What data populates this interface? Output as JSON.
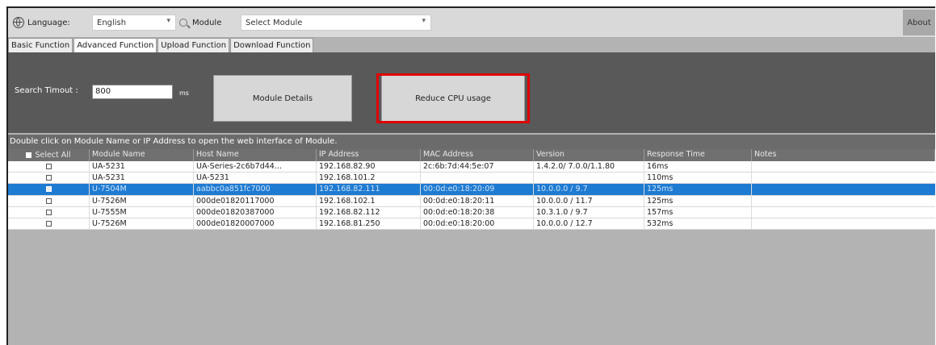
{
  "toolbar": {
    "language_label": "Language:",
    "language_value": "English",
    "module_label": "Module",
    "module_value": "Select Module",
    "about_label": "About"
  },
  "tabs": [
    {
      "label": "Basic Function",
      "active": false
    },
    {
      "label": "Advanced Function",
      "active": true
    },
    {
      "label": "Upload Function",
      "active": false
    },
    {
      "label": "Download Function",
      "active": false
    }
  ],
  "panel": {
    "search_timeout_label": "Search Timout :",
    "search_timeout_value": "800",
    "unit": "ms",
    "module_details_button": "Module Details",
    "reduce_cpu_button": "Reduce CPU usage",
    "highlight_color": "#e00000"
  },
  "hint": "Double click on Module Name or IP Address to open the web interface of Module.",
  "table": {
    "headers": [
      "Select All",
      "Module Name",
      "Host Name",
      "IP Address",
      "MAC Address",
      "Version",
      "Response Time",
      "Notes"
    ],
    "rows": [
      {
        "checked": false,
        "selected": false,
        "cells": [
          "UA-5231",
          "UA-Series-2c6b7d44...",
          "192.168.82.90",
          "2c:6b:7d:44:5e:07",
          "1.4.2.0/ 7.0.0/1.1.80",
          "16ms",
          ""
        ]
      },
      {
        "checked": false,
        "selected": false,
        "cells": [
          "UA-5231",
          "UA-5231",
          "192.168.101.2",
          "",
          "",
          "110ms",
          ""
        ]
      },
      {
        "checked": true,
        "selected": true,
        "cells": [
          "U-7504M",
          "aabbc0a851fc7000",
          "192.168.82.111",
          "00:0d:e0:18:20:09",
          "10.0.0.0 / 9.7",
          "125ms",
          ""
        ]
      },
      {
        "checked": false,
        "selected": false,
        "cells": [
          "U-7526M",
          "000de01820117000",
          "192.168.102.1",
          "00:0d:e0:18:20:11",
          "10.0.0.0 / 11.7",
          "125ms",
          ""
        ]
      },
      {
        "checked": false,
        "selected": false,
        "cells": [
          "U-7555M",
          "000de01820387000",
          "192.168.82.112",
          "00:0d:e0:18:20:38",
          "10.3.1.0 / 9.7",
          "157ms",
          ""
        ]
      },
      {
        "checked": false,
        "selected": false,
        "cells": [
          "U-7526M",
          "000de01820007000",
          "192.168.81.250",
          "00:0d:e0:18:20:00",
          "10.0.0.0 / 12.7",
          "532ms",
          ""
        ]
      }
    ]
  },
  "colors": {
    "selected_row": "#1e7bd2",
    "panel_bg": "#595959",
    "window_bg": "#b3b3b3"
  }
}
